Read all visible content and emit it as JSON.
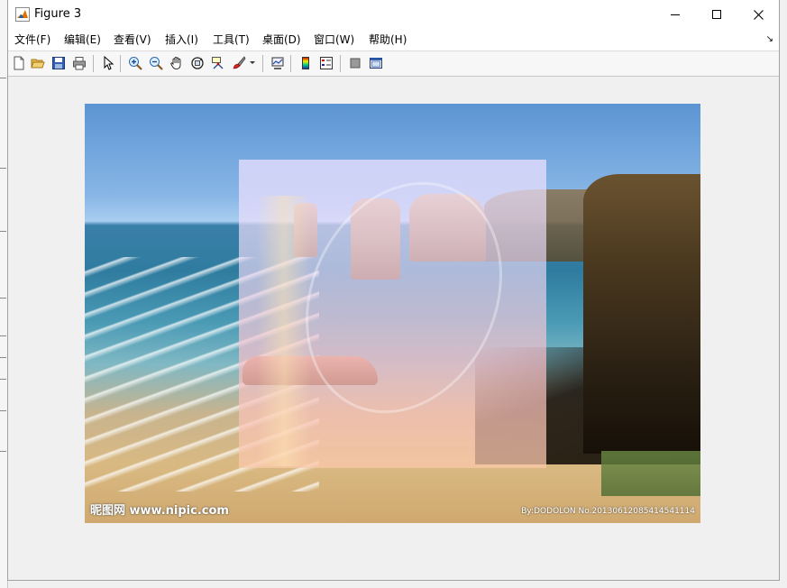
{
  "window": {
    "title": "Figure 3",
    "controls": {
      "minimize": "minimize",
      "maximize": "maximize",
      "close": "close"
    }
  },
  "menu": {
    "items": [
      {
        "label": "文件(F)"
      },
      {
        "label": "编辑(E)"
      },
      {
        "label": "查看(V)"
      },
      {
        "label": "插入(I)"
      },
      {
        "label": "工具(T)"
      },
      {
        "label": "桌面(D)"
      },
      {
        "label": "窗口(W)"
      },
      {
        "label": "帮助(H)"
      }
    ]
  },
  "toolbar": {
    "buttons": [
      {
        "icon": "new-figure-icon"
      },
      {
        "icon": "open-file-icon"
      },
      {
        "icon": "save-icon"
      },
      {
        "icon": "print-icon"
      },
      {
        "icon": "pointer-icon"
      },
      {
        "icon": "zoom-in-icon"
      },
      {
        "icon": "zoom-out-icon"
      },
      {
        "icon": "pan-icon"
      },
      {
        "icon": "rotate-3d-icon"
      },
      {
        "icon": "data-cursor-icon"
      },
      {
        "icon": "brush-icon"
      },
      {
        "icon": "link-plot-icon"
      },
      {
        "icon": "colorbar-icon"
      },
      {
        "icon": "legend-icon"
      },
      {
        "icon": "hide-plot-tools-icon"
      },
      {
        "icon": "show-plot-tools-icon"
      }
    ]
  },
  "image": {
    "watermark_left": "昵图网 www.nipic.com",
    "watermark_right": "By:DODOLON  No.20130612085414541114"
  },
  "colors": {
    "titlebar": "#ffffff",
    "window_bg": "#f0f0f0",
    "accent_matlab": "#e07000"
  }
}
